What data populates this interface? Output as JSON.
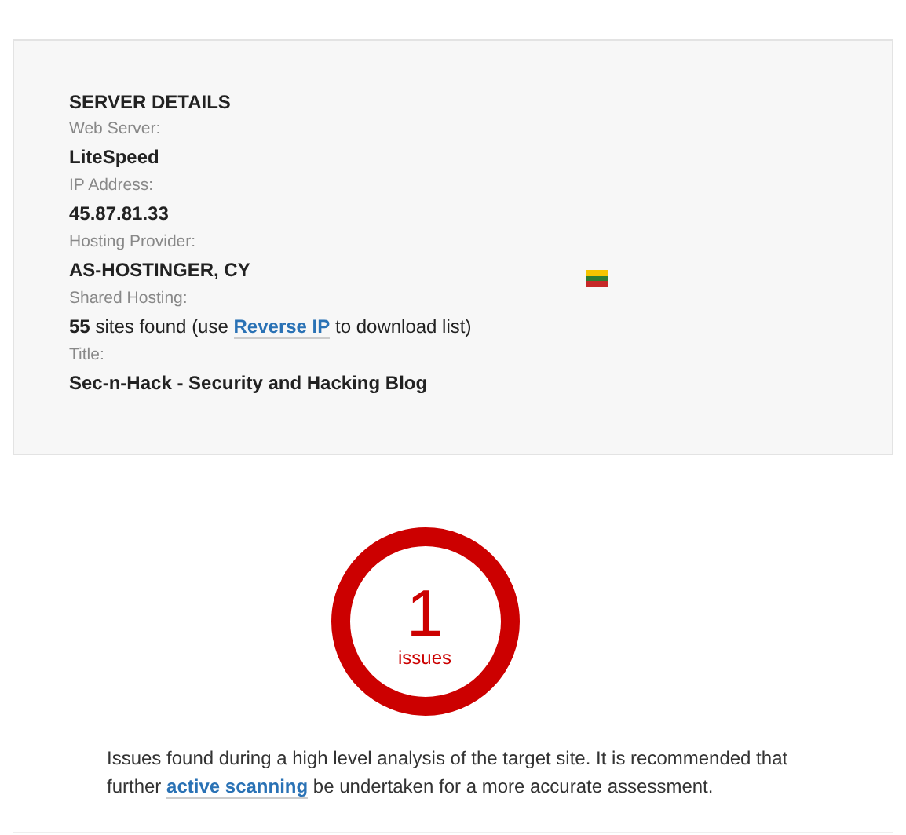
{
  "server_details": {
    "heading": "SERVER DETAILS",
    "fields": [
      {
        "label": "Web Server:",
        "value": "LiteSpeed"
      },
      {
        "label": "IP Address:",
        "value": "45.87.81.33"
      },
      {
        "label": "Hosting Provider:",
        "value": "AS-HOSTINGER, CY"
      },
      {
        "label": "Shared Hosting:",
        "kind": "shared",
        "before": "**55** sites found (use",
        "link": "Reverse IP",
        "after": "to download list)"
      },
      {
        "label": "Title:",
        "value": "Sec-n-Hack - Security and Hacking Blog"
      }
    ]
  },
  "issues": {
    "count": "1",
    "unit": "issues",
    "color": "#cc0000",
    "note_before": "Issues found during a high level analysis of the target site. It is recommended that further",
    "note_link": "active scanning",
    "note_after": "be undertaken for a more accurate assessment."
  }
}
